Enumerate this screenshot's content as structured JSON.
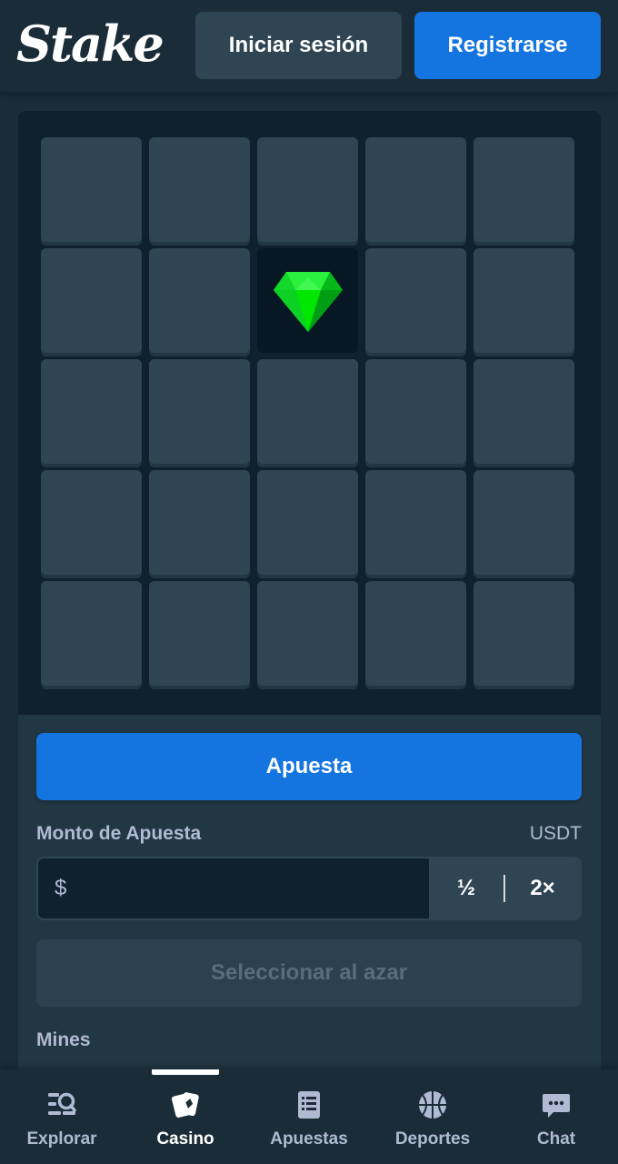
{
  "header": {
    "logo_text": "Stake",
    "login_label": "Iniciar sesión",
    "register_label": "Registrarse"
  },
  "game": {
    "rows": 5,
    "cols": 5,
    "revealed": [
      {
        "row": 2,
        "col": 3,
        "content": "gem-icon"
      }
    ]
  },
  "controls": {
    "bet_button_label": "Apuesta",
    "bet_amount_label": "Monto de Apuesta",
    "currency": "USDT",
    "bet_input_prefix": "$",
    "bet_input_value": "",
    "half_label": "½",
    "double_label": "2×",
    "random_button_label": "Seleccionar al azar",
    "mines_label": "Mines"
  },
  "nav": {
    "items": [
      {
        "label": "Explorar",
        "icon": "search-list-icon",
        "active": false
      },
      {
        "label": "Casino",
        "icon": "cards-icon",
        "active": true
      },
      {
        "label": "Apuestas",
        "icon": "betslip-icon",
        "active": false
      },
      {
        "label": "Deportes",
        "icon": "basketball-icon",
        "active": false
      },
      {
        "label": "Chat",
        "icon": "chat-icon",
        "active": false
      }
    ]
  },
  "colors": {
    "background": "#1a2c38",
    "panel_dark": "#0f212e",
    "panel": "#213743",
    "tile": "#2f4553",
    "primary": "#1475e1",
    "muted_text": "#b1bad3",
    "gem": "#00e701"
  }
}
